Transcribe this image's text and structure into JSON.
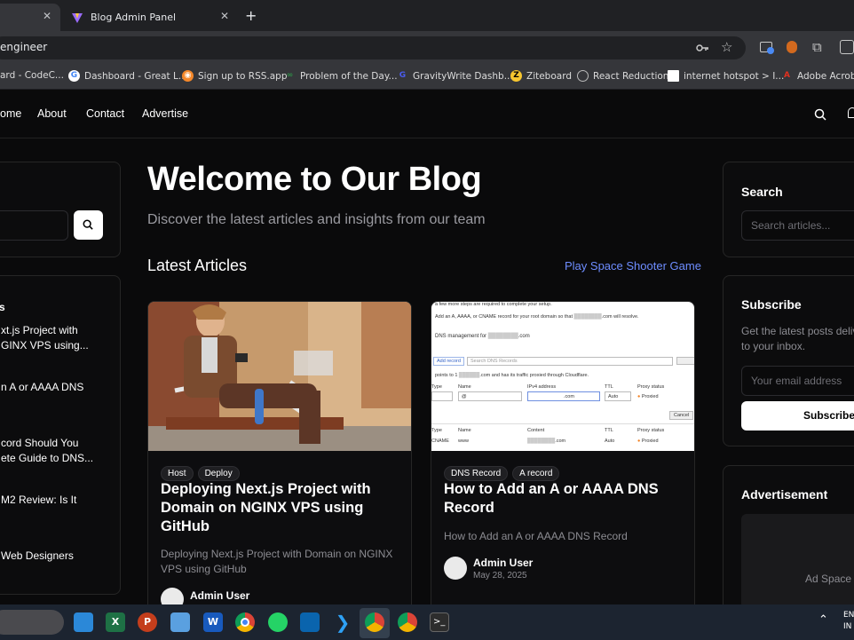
{
  "browser": {
    "tabs": [
      {
        "label": ""
      },
      {
        "label": "Blog Admin Panel"
      }
    ],
    "new_tab": "+",
    "url": "engineer",
    "bookmarks": [
      "ard - CodeC...",
      "Dashboard - Great L...",
      "Sign up to RSS.app",
      "Problem of the Day...",
      "GravityWrite Dashb...",
      "Ziteboard",
      "React Reduction",
      "internet hotspot > I...",
      "Adobe Acroba"
    ]
  },
  "nav": {
    "links": [
      "ome",
      "About",
      "Contact",
      "Advertise"
    ]
  },
  "hero": {
    "title": "Welcome to Our Blog",
    "subtitle": "Discover the latest articles and insights from our team"
  },
  "latest": {
    "heading": "Latest Articles",
    "game_link": "Play Space Shooter Game"
  },
  "left_sidebar": {
    "heading_fragment": "s",
    "items": [
      {
        "line1": "xt.js Project with",
        "line2": "GINX VPS using..."
      },
      {
        "line1": "n A or AAAA DNS",
        "line2": ""
      },
      {
        "line1": "cord Should You",
        "line2": "ete Guide to DNS..."
      },
      {
        "line1": "M2 Review: Is It",
        "line2": ""
      },
      {
        "line1": "Web Designers",
        "line2": ""
      }
    ]
  },
  "articles": [
    {
      "tags": [
        "Host",
        "Deploy"
      ],
      "title": "Deploying Next.js Project with Domain on NGINX VPS using GitHub",
      "excerpt": "Deploying Next.js Project with Domain on NGINX VPS using GitHub",
      "author": "Admin User",
      "date": ""
    },
    {
      "tags": [
        "DNS Record",
        "A record"
      ],
      "title": "How to Add an A or AAAA DNS Record",
      "excerpt": "How to Add an A or AAAA DNS Record",
      "author": "Admin User",
      "date": "May 28, 2025"
    }
  ],
  "right_sidebar": {
    "search_heading": "Search",
    "search_placeholder": "Search articles...",
    "subscribe_heading": "Subscribe",
    "subscribe_text_1": "Get the latest posts deliv",
    "subscribe_text_2": "to your inbox.",
    "email_placeholder": "Your email address",
    "subscribe_button": "Subscribe",
    "ad_heading": "Advertisement",
    "ad_space": "Ad Space"
  },
  "dns_screenshot": {
    "line1": "a few more steps are required to complete your setup.",
    "line2": "Add an A, AAAA, or CNAME record for your root domain so that",
    "line2b": ".com will resolve.",
    "mgmt": "DNS management for",
    "mgmt_domain": ".com",
    "add_record": "Add record",
    "search_placeholder": "Search DNS Records",
    "points_to": "points to 1",
    "points_rest": ".com and has its traffic proxied through Cloudflare.",
    "col_type": "Type",
    "col_name": "Name",
    "col_content": "Content",
    "col_ttl": "TTL",
    "col_proxy": "Proxy status",
    "ipv4_label": "IPv4 address",
    "name_val": "@",
    "auto": "Auto",
    "proxied": "Proxied",
    "cancel": "Cancel",
    "row_type": "CNAME",
    "row_name": "www",
    "row_content": ".com",
    "row_ttl": "Auto",
    "row_proxy": "Proxied"
  },
  "taskbar": {
    "lang_1": "EN",
    "lang_2": "IN"
  }
}
